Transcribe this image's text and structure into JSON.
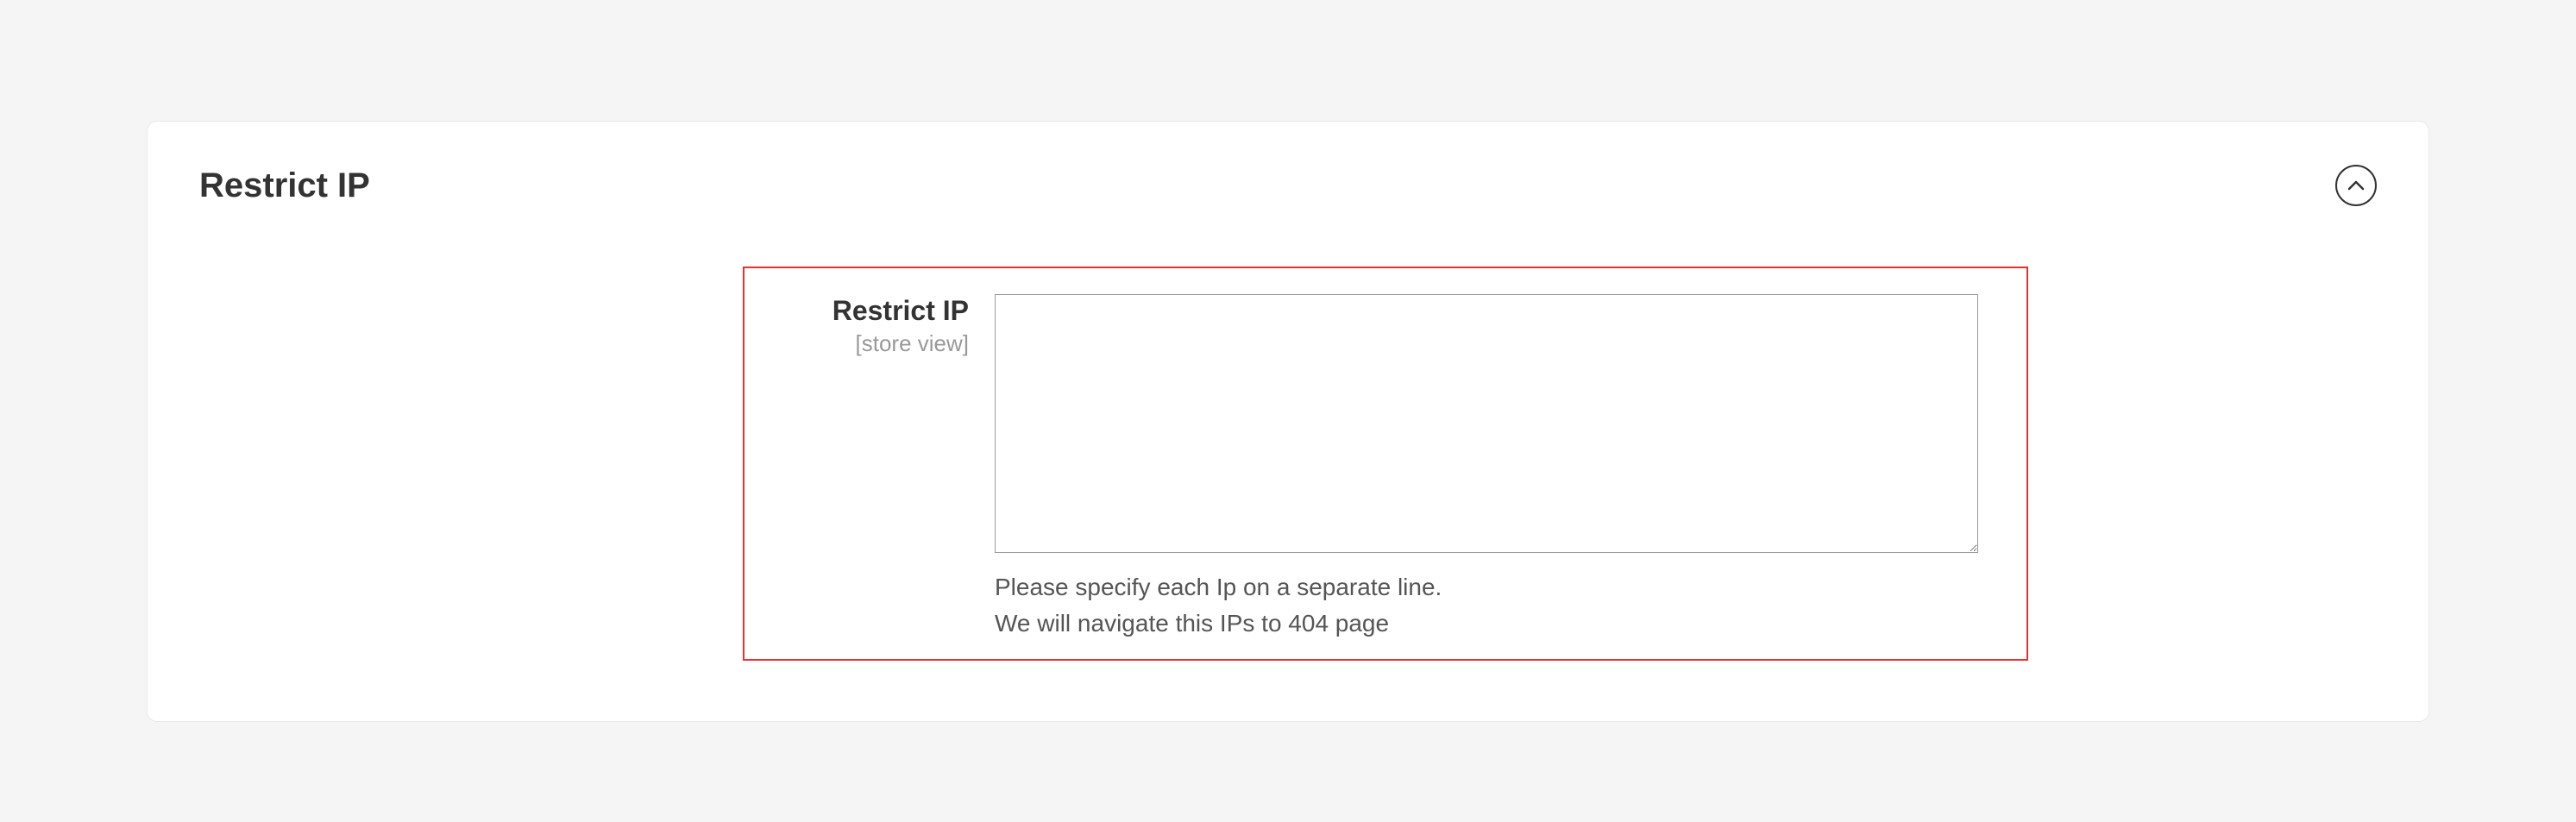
{
  "panel": {
    "title": "Restrict IP"
  },
  "field": {
    "label": "Restrict IP",
    "scope": "[store view]",
    "value": "",
    "hint_line1": "Please specify each Ip on a separate line.",
    "hint_line2": "We will navigate this IPs to 404 page"
  }
}
